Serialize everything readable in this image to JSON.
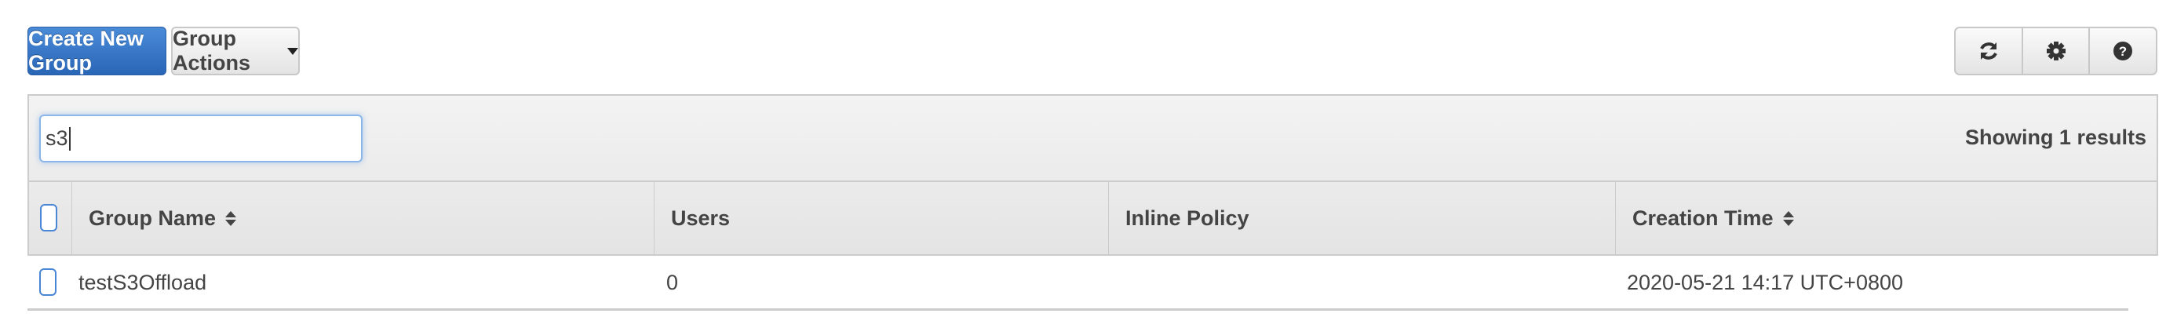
{
  "toolbar": {
    "create_label": "Create New Group",
    "actions_label": "Group Actions",
    "icons": [
      "refresh-icon",
      "gear-icon",
      "help-icon"
    ]
  },
  "filter": {
    "value": "s3",
    "results_text": "Showing 1 results"
  },
  "table": {
    "columns": [
      {
        "label": "Group Name",
        "sortable": true
      },
      {
        "label": "Users",
        "sortable": false
      },
      {
        "label": "Inline Policy",
        "sortable": false
      },
      {
        "label": "Creation Time",
        "sortable": true
      }
    ],
    "rows": [
      {
        "group_name": "testS3Offload",
        "users": "0",
        "inline_policy": "",
        "creation_time": "2020-05-21 14:17 UTC+0800",
        "selected": false
      }
    ]
  },
  "colors": {
    "primary": "#2f6fc0",
    "checkbox_border": "#4a86d6"
  }
}
